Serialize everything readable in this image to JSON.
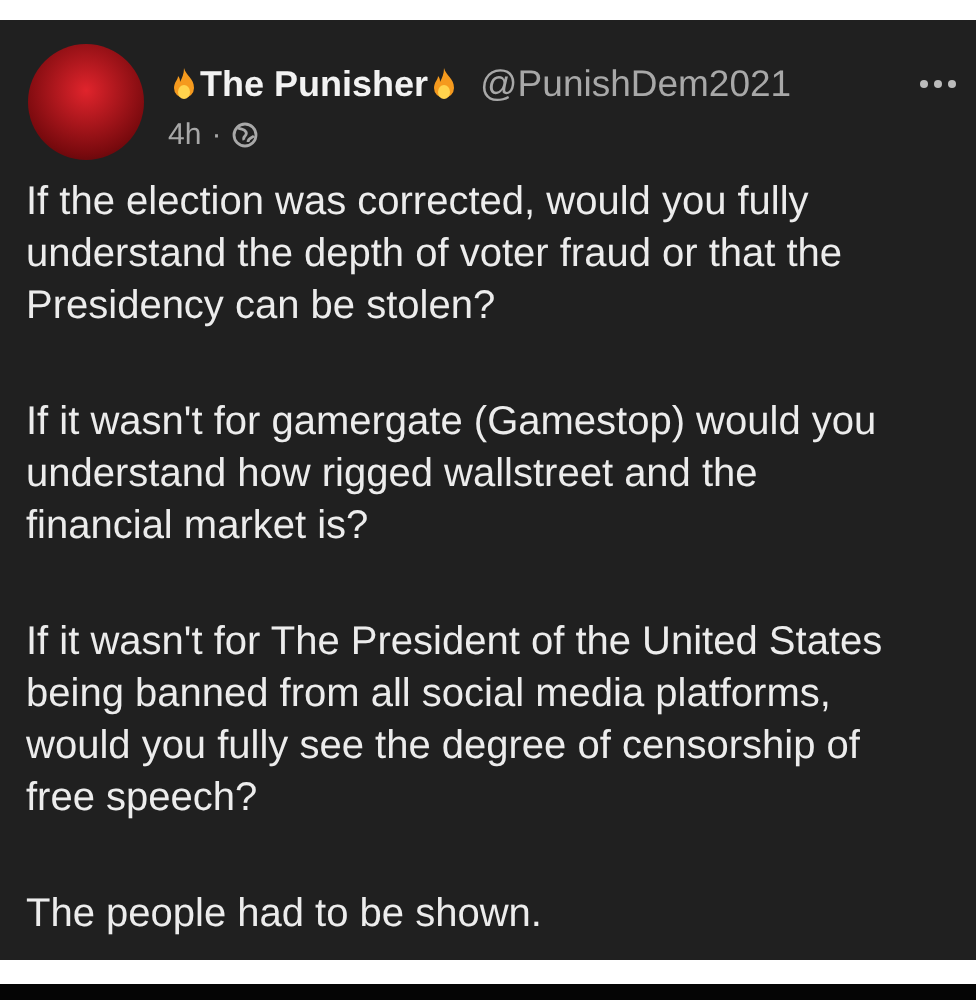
{
  "post": {
    "author": {
      "name": "The Punisher",
      "handle": "@PunishDem2021"
    },
    "time": "4h",
    "separator": "·",
    "paragraphs": [
      "If the election was corrected, would you fully\nunderstand the depth of voter fraud or that the\nPresidency can be stolen?",
      "If it wasn't for gamergate (Gamestop) would you\nunderstand how rigged wallstreet and the\nfinancial market is?",
      "If it wasn't for The President of the United States\nbeing banned from all social media platforms,\nwould you fully see the degree of censorship of\nfree speech?",
      "The people had to be shown."
    ]
  }
}
